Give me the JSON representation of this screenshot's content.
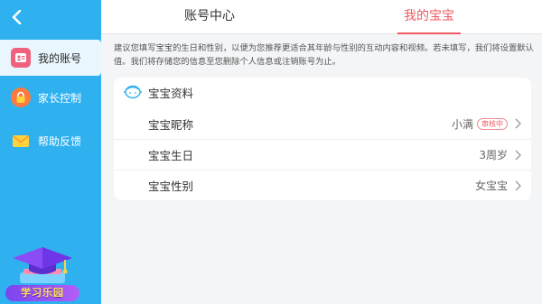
{
  "sidebar": {
    "items": [
      {
        "label": "我的账号",
        "icon": "account-icon",
        "active": true
      },
      {
        "label": "家长控制",
        "icon": "lock-icon",
        "active": false
      },
      {
        "label": "帮助反馈",
        "icon": "mail-icon",
        "active": false
      }
    ],
    "promo_label": "学习乐园"
  },
  "tabs": [
    {
      "label": "账号中心",
      "active": false
    },
    {
      "label": "我的宝宝",
      "active": true
    }
  ],
  "notice": "建议您填写宝宝的生日和性别，以便为您推荐更适合其年龄与性别的互动内容和视频。若未填写，我们将设置默认值。我们将存储您的信息至您删除个人信息或注销账号为止。",
  "card": {
    "title": "宝宝资料",
    "rows": [
      {
        "label": "宝宝昵称",
        "value": "小满",
        "badge": "审核中"
      },
      {
        "label": "宝宝生日",
        "value": "3周岁"
      },
      {
        "label": "宝宝性别",
        "value": "女宝宝"
      }
    ]
  },
  "colors": {
    "sidebar": "#2fb1f0",
    "accent": "#ef5a62"
  }
}
